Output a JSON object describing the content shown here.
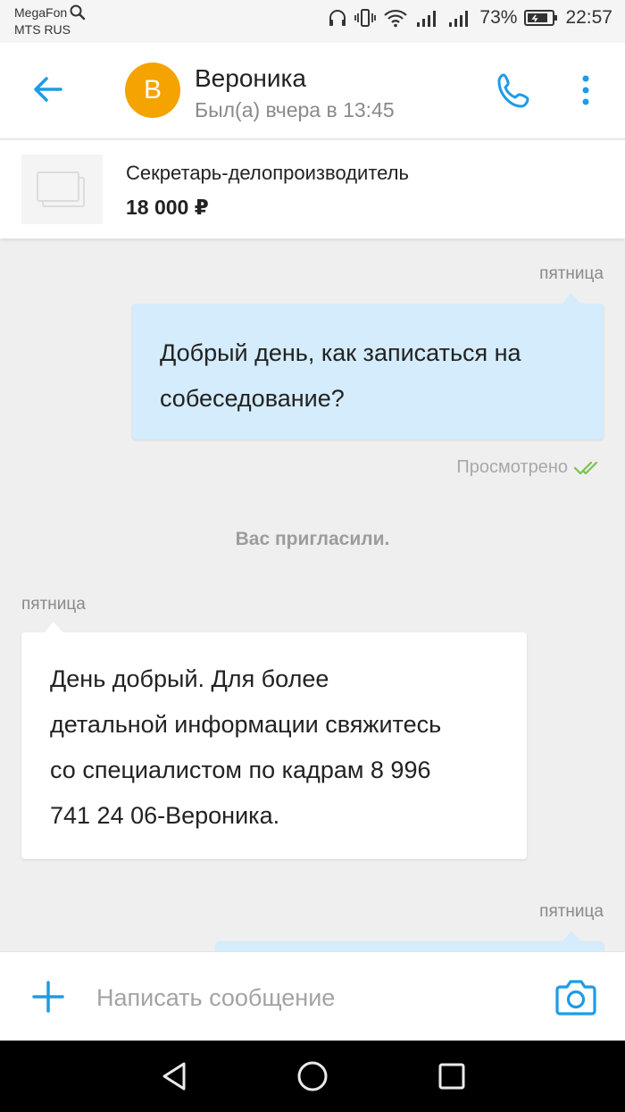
{
  "status_bar": {
    "carrier_1": "MegaFon",
    "carrier_2": "MTS RUS",
    "battery": "73%",
    "time": "22:57"
  },
  "header": {
    "avatar_letter": "В",
    "contact_name": "Вероника",
    "contact_status": "Был(а) вчера в 13:45",
    "avatar_color": "#f5a300",
    "accent_color": "#1e9be6"
  },
  "vacancy": {
    "title": "Секретарь-делопроизводитель",
    "salary": "18 000 ₽"
  },
  "messages": {
    "day_1": "пятница",
    "out_1_line_1": "Добрый день, как записаться на",
    "out_1_line_2": "собеседование?",
    "seen_label": "Просмотрено",
    "system_note": "Вас пригласили.",
    "day_2": "пятница",
    "in_1_line_1": "День добрый. Для более",
    "in_1_line_2": "детальной информации свяжитесь",
    "in_1_line_3": "со специалистом по кадрам 8 996",
    "in_1_line_4": "741 24 06-Вероника.",
    "day_3": "пятница"
  },
  "composer": {
    "placeholder": "Написать сообщение"
  },
  "icons": {
    "back": "arrow-left-icon",
    "call": "phone-icon",
    "menu": "more-vertical-icon",
    "add": "plus-icon",
    "camera": "camera-icon",
    "seen": "double-check-icon"
  }
}
